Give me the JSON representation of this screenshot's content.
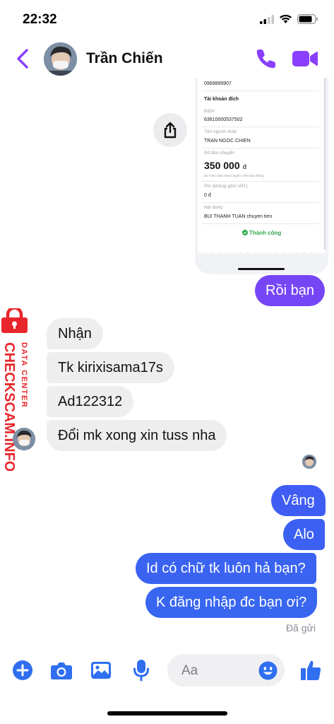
{
  "status_bar": {
    "time": "22:32"
  },
  "header": {
    "contact_name": "Trần Chiến"
  },
  "receipt": {
    "phone": "0969899907",
    "section_title": "Tài khoản đích",
    "bank": "BIDV",
    "account_number": "63610000537502",
    "recipient_label": "Tên người nhận",
    "recipient_name": "TRAN NGOC CHIEN",
    "amount_label": "Số tiền chuyển",
    "amount": "350 000",
    "currency": "đ",
    "amount_words": "Ba Trăm Năm Mươi Nghìn Việt Nam Đồng",
    "fee_label": "Phí (không gồm VAT)",
    "fee": "0 đ",
    "content_label": "Nội dung",
    "content": "BUI THANH TUAN chuyen tien",
    "status": "Thành công"
  },
  "messages": [
    {
      "side": "out",
      "text": "Rồi bạn"
    },
    {
      "side": "in",
      "text": "Nhận"
    },
    {
      "side": "in",
      "text": "Tk kirixisama17s"
    },
    {
      "side": "in",
      "text": "Ad122312"
    },
    {
      "side": "in",
      "text": "Đổi mk xong xin tuss nha"
    },
    {
      "side": "out",
      "text": "Vâng"
    },
    {
      "side": "out",
      "text": "Alo"
    },
    {
      "side": "out",
      "text": "Id có chữ tk luôn hả bạn?"
    },
    {
      "side": "out",
      "text": "K đăng nhập đc bạn ơi?"
    }
  ],
  "sent_status": "Đã gửi",
  "watermark": {
    "line1": "CHECKSCAM.INFO",
    "line2": "DATA CENTER"
  },
  "composer": {
    "placeholder": "Aa"
  },
  "colors": {
    "accent_purple": "#8a3ffc",
    "bubble_purple": "#7646f6",
    "bubble_blue": "#3a63f1",
    "incoming_gray": "#eeeeef",
    "composer_blue": "#2f6ff0",
    "watermark_red": "#e8262b"
  },
  "icons": [
    "back-arrow-icon",
    "phone-call-icon",
    "video-call-icon",
    "share-icon",
    "plus-circle-icon",
    "camera-icon",
    "image-icon",
    "microphone-icon",
    "emoji-icon",
    "thumbs-up-icon",
    "padlock-icon"
  ]
}
